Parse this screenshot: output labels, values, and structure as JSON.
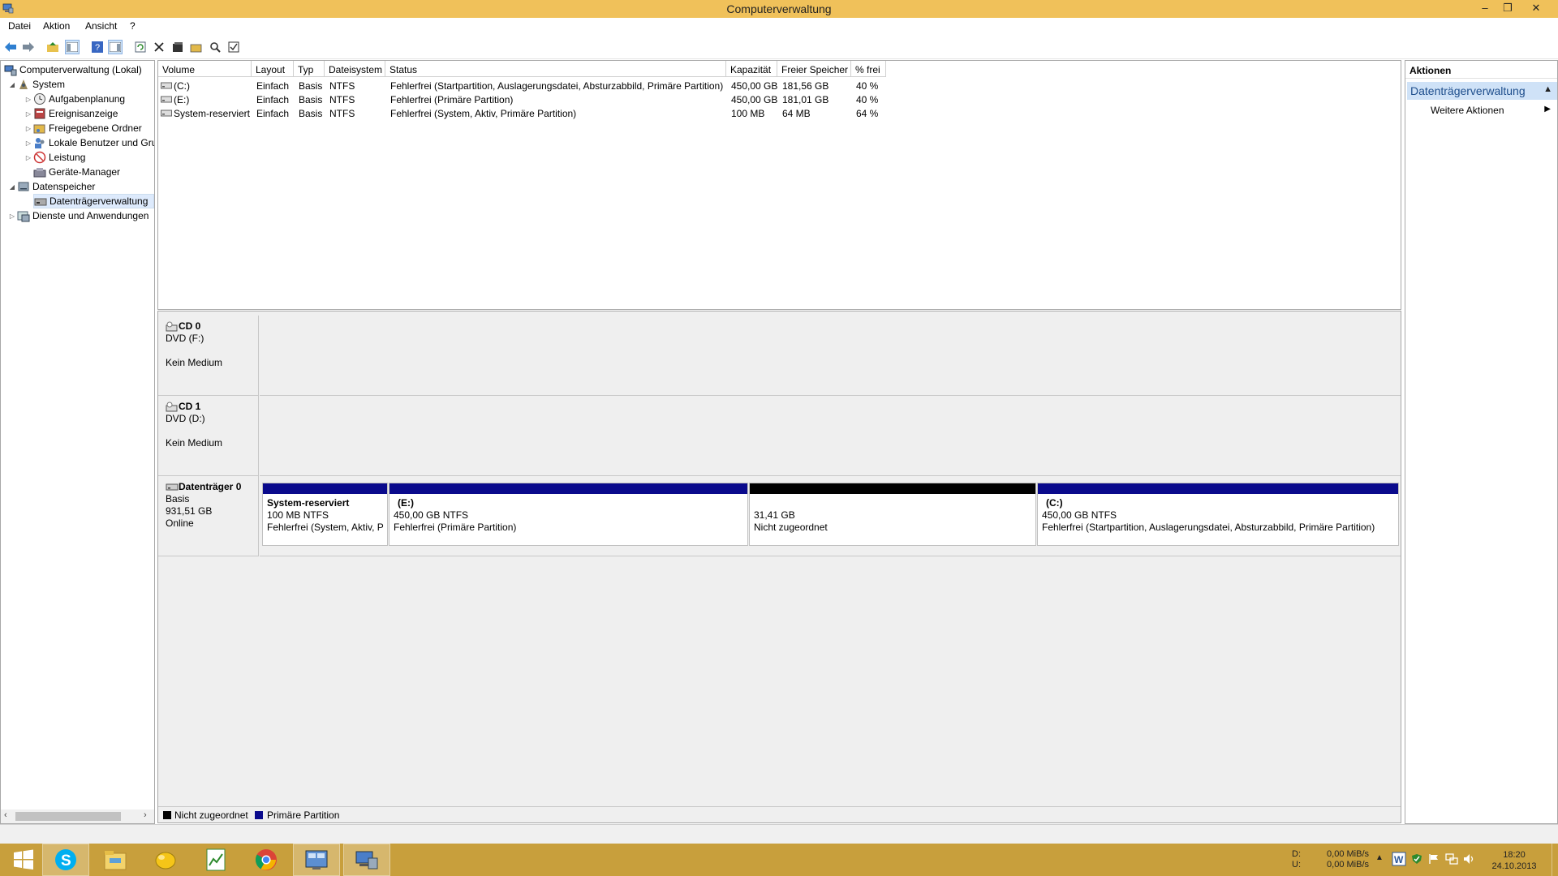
{
  "window": {
    "title": "Computerverwaltung",
    "minimize": "–",
    "restore": "❐",
    "close": "✕"
  },
  "menu": [
    "Datei",
    "Aktion",
    "Ansicht",
    "?"
  ],
  "tree": {
    "root": "Computerverwaltung (Lokal)",
    "system": "System",
    "system_children": [
      "Aufgabenplanung",
      "Ereignisanzeige",
      "Freigegebene Ordner",
      "Lokale Benutzer und Gruppen",
      "Leistung",
      "Geräte-Manager"
    ],
    "storage": "Datenspeicher",
    "storage_children": [
      "Datenträgerverwaltung"
    ],
    "services": "Dienste und Anwendungen"
  },
  "volume_table": {
    "columns": [
      "Volume",
      "Layout",
      "Typ",
      "Dateisystem",
      "Status",
      "Kapazität",
      "Freier Speicher",
      "% frei"
    ],
    "rows": [
      [
        "(C:)",
        "Einfach",
        "Basis",
        "NTFS",
        "Fehlerfrei (Startpartition, Auslagerungsdatei, Absturzabbild, Primäre Partition)",
        "450,00 GB",
        "181,56 GB",
        "40 %"
      ],
      [
        "(E:)",
        "Einfach",
        "Basis",
        "NTFS",
        "Fehlerfrei (Primäre Partition)",
        "450,00 GB",
        "181,01 GB",
        "40 %"
      ],
      [
        "System-reserviert",
        "Einfach",
        "Basis",
        "NTFS",
        "Fehlerfrei (System, Aktiv, Primäre Partition)",
        "100 MB",
        "64 MB",
        "64 %"
      ]
    ]
  },
  "disks": {
    "cd0": {
      "name": "CD 0",
      "type": "DVD (F:)",
      "status": "Kein Medium"
    },
    "cd1": {
      "name": "CD 1",
      "type": "DVD (D:)",
      "status": "Kein Medium"
    },
    "disk0": {
      "name": "Datenträger 0",
      "type": "Basis",
      "size": "931,51 GB",
      "status": "Online",
      "partitions": [
        {
          "name": "System-reserviert",
          "size": "100 MB NTFS",
          "status": "Fehlerfrei (System, Aktiv, P"
        },
        {
          "name": "(E:)",
          "size": "450,00 GB NTFS",
          "status": "Fehlerfrei (Primäre Partition)"
        },
        {
          "name": "",
          "size": "31,41 GB",
          "status": "Nicht zugeordnet"
        },
        {
          "name": "(C:)",
          "size": "450,00 GB NTFS",
          "status": "Fehlerfrei (Startpartition, Auslagerungsdatei, Absturzabbild, Primäre Partition)"
        }
      ]
    }
  },
  "legend": {
    "unallocated": "Nicht zugeordnet",
    "primary": "Primäre Partition"
  },
  "actions": {
    "header": "Aktionen",
    "section": "Datenträgerverwaltung",
    "item": "Weitere Aktionen"
  },
  "tray": {
    "disk_labels": [
      "D:",
      "U:"
    ],
    "disk_rates": [
      "0,00 MiB/s",
      "0,00 MiB/s"
    ],
    "time": "18:20",
    "date": "24.10.2013"
  },
  "colors": {
    "titlebar": "#f0c15a",
    "taskbar": "#c89f3c",
    "primary_partition": "#0a0a8c",
    "unallocated": "#000000"
  }
}
